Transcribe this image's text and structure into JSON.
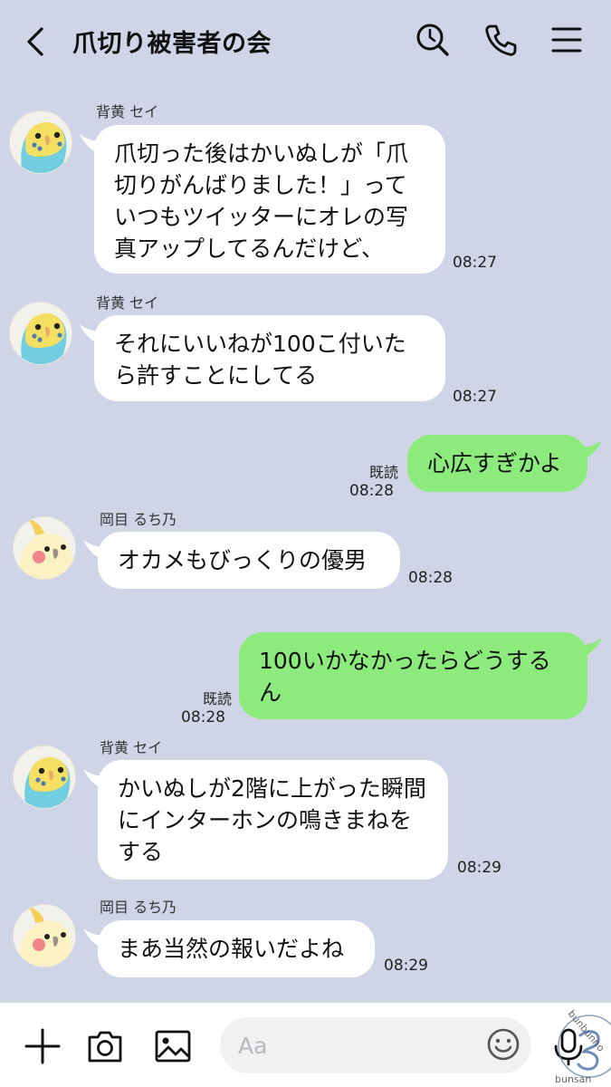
{
  "header": {
    "title": "爪切り被害者の会",
    "icons": [
      "back-chevron-icon",
      "search-icon",
      "phone-icon",
      "menu-icon"
    ]
  },
  "messages": [
    {
      "sender": "背黄 セイ",
      "avatar": "budgie-avatar",
      "text": "爪切った後はかいぬしが「爪切りがんばりました！」っていつもツイッターにオレの写真アップしてるんだけど、",
      "time": "08:27",
      "direction": "in"
    },
    {
      "sender": "背黄 セイ",
      "avatar": "budgie-avatar",
      "text": "それにいいねが100こ付いたら許すことにしてる",
      "time": "08:27",
      "direction": "in"
    },
    {
      "text": "心広すぎかよ",
      "read": "既読",
      "time": "08:28",
      "direction": "out"
    },
    {
      "sender": "岡目 るち乃",
      "avatar": "cockatiel-avatar",
      "text": "オカメもびっくりの優男",
      "time": "08:28",
      "direction": "in"
    },
    {
      "text": "100いかなかったらどうするん",
      "read": "既読",
      "time": "08:28",
      "direction": "out"
    },
    {
      "sender": "背黄 セイ",
      "avatar": "budgie-avatar",
      "text": "かいぬしが2階に上がった瞬間にインターホンの鳴きまねをする",
      "time": "08:29",
      "direction": "in"
    },
    {
      "sender": "岡目 るち乃",
      "avatar": "cockatiel-avatar",
      "text": "まあ当然の報いだよね",
      "time": "08:29",
      "direction": "in"
    }
  ],
  "bottombar": {
    "input_placeholder": "Aa",
    "icons": [
      "plus-icon",
      "camera-icon",
      "image-icon",
      "emoji-icon",
      "microphone-icon"
    ]
  },
  "watermark": "bunbunno bunsan",
  "colors": {
    "background": "#cfd4e6",
    "incoming_bubble": "#ffffff",
    "outgoing_bubble": "#8deb7d"
  }
}
